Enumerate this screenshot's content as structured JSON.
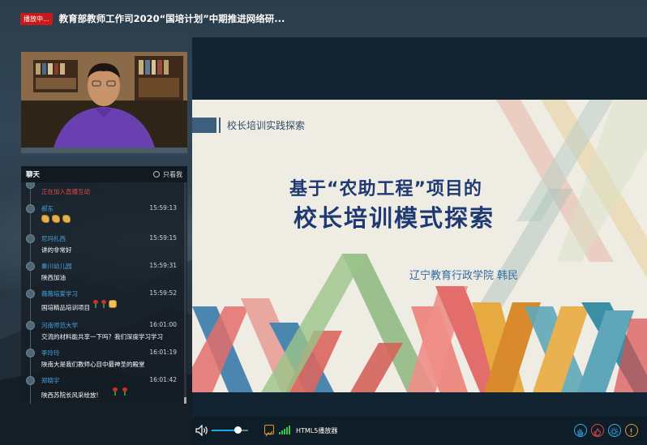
{
  "header": {
    "live_badge": "播放中...",
    "title": "教育部教师工作司2020“国培计划”中期推进网络研..."
  },
  "chat": {
    "title": "聊天",
    "only_me_label": "只看我",
    "system_message": "正在加入直播互动",
    "messages": [
      {
        "name": "郝东",
        "time": "15:59:13",
        "text": ""
      },
      {
        "name": "尼玛扎西",
        "time": "15:59:15",
        "text": "讲的非常好"
      },
      {
        "name": "秦川幼儿园",
        "time": "15:59:31",
        "text": "陕西加油"
      },
      {
        "name": "薇薇培爱学习",
        "time": "15:59:52",
        "text": "国培精品培训项目"
      },
      {
        "name": "河南师范大学",
        "time": "16:01:00",
        "text": "交流的材料能共享一下吗？我们深度学习学习"
      },
      {
        "name": "李玲玲",
        "time": "16:01:19",
        "text": "陕南大是我们教师心目中最神圣的殿堂"
      },
      {
        "name": "郑晓宇",
        "time": "16:01:42",
        "text": "陕西苏院长风采绘放!"
      }
    ]
  },
  "slide": {
    "header_label": "校长培训实践探索",
    "title_line1": "基于“农助工程”项目的",
    "title_line2": "校长培训模式探索",
    "author": "辽宁教育行政学院   韩民"
  },
  "controls": {
    "volume_level": 0.7,
    "player_label": "HTML5播放器"
  },
  "colors": {
    "accent": "#1aa5e6",
    "live_red": "#c81a1a",
    "chat_name": "#4aa3df",
    "slide_title": "#1f3a73"
  }
}
